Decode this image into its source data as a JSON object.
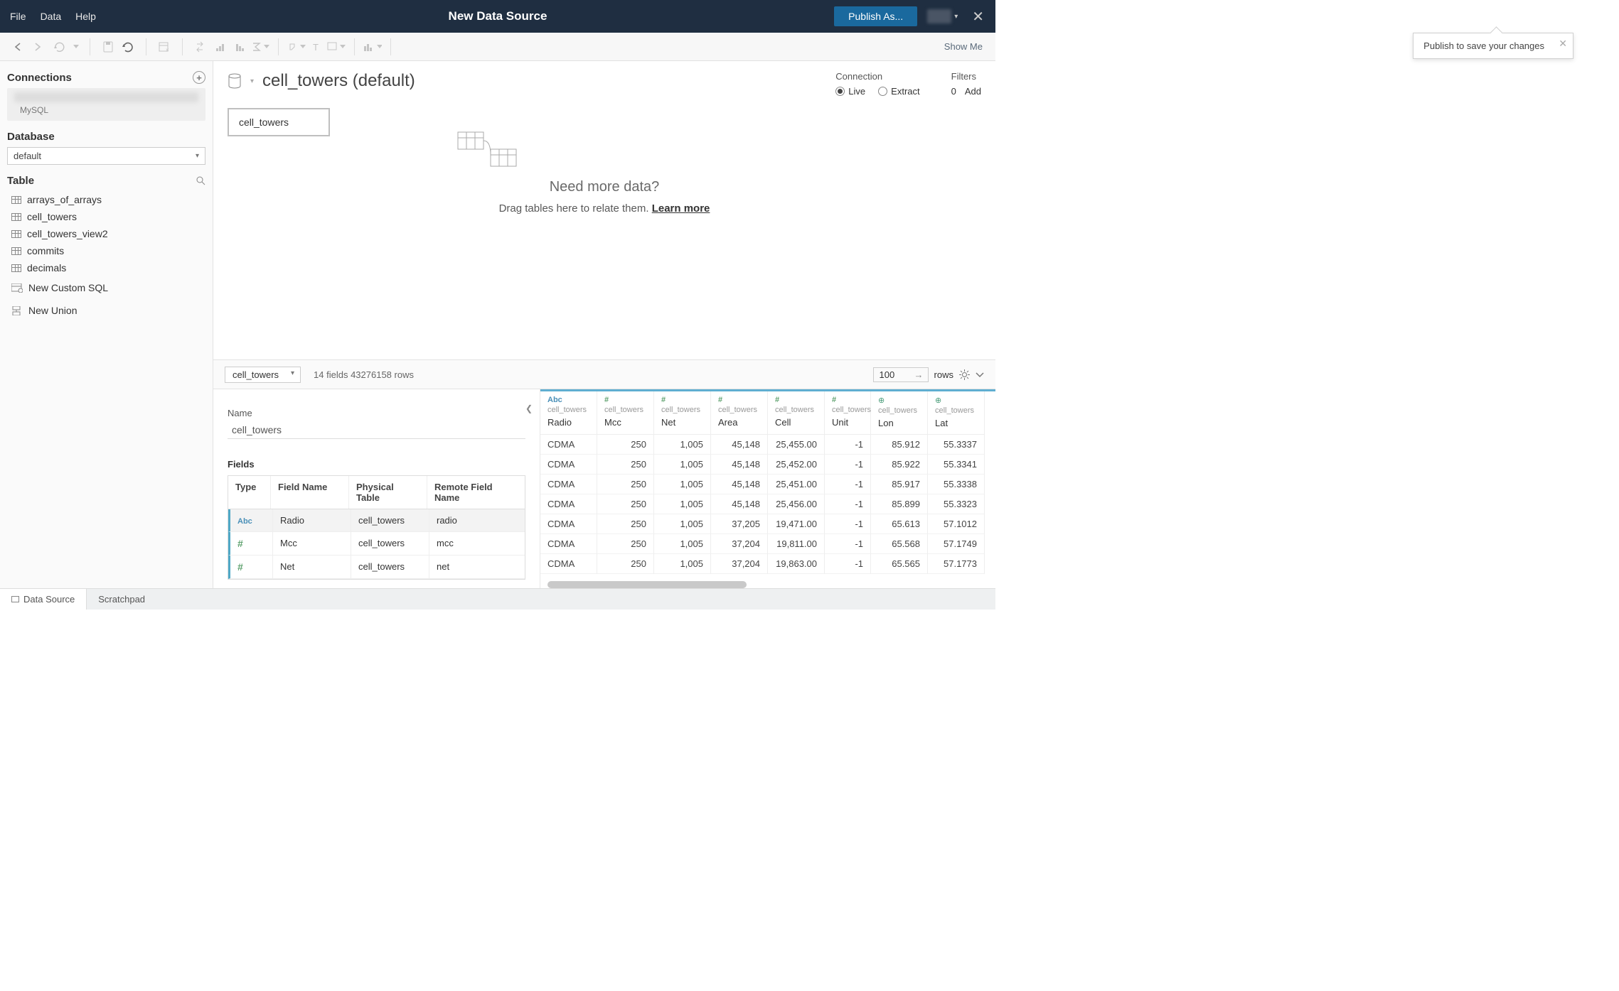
{
  "menubar": {
    "file": "File",
    "data": "Data",
    "help": "Help"
  },
  "titlebar": {
    "title": "New Data Source",
    "publish": "Publish As..."
  },
  "tooltip": {
    "text": "Publish to save your changes"
  },
  "showme": "Show Me",
  "sidebar": {
    "connections_label": "Connections",
    "connection_type": "MySQL",
    "database_label": "Database",
    "database_value": "default",
    "table_label": "Table",
    "tables": [
      "arrays_of_arrays",
      "cell_towers",
      "cell_towers_view2",
      "commits",
      "decimals"
    ],
    "custom_sql": "New Custom SQL",
    "new_union": "New Union"
  },
  "canvas": {
    "datasource_name": "cell_towers (default)",
    "chip": "cell_towers",
    "connection_label": "Connection",
    "live": "Live",
    "extract": "Extract",
    "filters_label": "Filters",
    "filters_count": "0",
    "filters_add": "Add",
    "need_more": "Need more data?",
    "drag_here": "Drag tables here to relate them. ",
    "learn_more": "Learn more"
  },
  "lower": {
    "table_select": "cell_towers",
    "fields_info": "14 fields 43276158 rows",
    "rows_value": "100",
    "rows_label": "rows",
    "name_label": "Name",
    "name_value": "cell_towers",
    "fields_label": "Fields",
    "ft_headers": {
      "type": "Type",
      "field": "Field Name",
      "physical": "Physical Table",
      "remote": "Remote Field Name"
    },
    "ft_rows": [
      {
        "type": "Abc",
        "field": "Radio",
        "physical": "cell_towers",
        "remote": "radio"
      },
      {
        "type": "#",
        "field": "Mcc",
        "physical": "cell_towers",
        "remote": "mcc"
      },
      {
        "type": "#",
        "field": "Net",
        "physical": "cell_towers",
        "remote": "net"
      }
    ]
  },
  "grid": {
    "source": "cell_towers",
    "columns": [
      {
        "name": "Radio",
        "type": "Abc"
      },
      {
        "name": "Mcc",
        "type": "#"
      },
      {
        "name": "Net",
        "type": "#"
      },
      {
        "name": "Area",
        "type": "#"
      },
      {
        "name": "Cell",
        "type": "#"
      },
      {
        "name": "Unit",
        "type": "#"
      },
      {
        "name": "Lon",
        "type": "geo"
      },
      {
        "name": "Lat",
        "type": "geo"
      }
    ],
    "rows": [
      [
        "CDMA",
        "250",
        "1,005",
        "45,148",
        "25,455.00",
        "-1",
        "85.912",
        "55.3337"
      ],
      [
        "CDMA",
        "250",
        "1,005",
        "45,148",
        "25,452.00",
        "-1",
        "85.922",
        "55.3341"
      ],
      [
        "CDMA",
        "250",
        "1,005",
        "45,148",
        "25,451.00",
        "-1",
        "85.917",
        "55.3338"
      ],
      [
        "CDMA",
        "250",
        "1,005",
        "45,148",
        "25,456.00",
        "-1",
        "85.899",
        "55.3323"
      ],
      [
        "CDMA",
        "250",
        "1,005",
        "37,205",
        "19,471.00",
        "-1",
        "65.613",
        "57.1012"
      ],
      [
        "CDMA",
        "250",
        "1,005",
        "37,204",
        "19,811.00",
        "-1",
        "65.568",
        "57.1749"
      ],
      [
        "CDMA",
        "250",
        "1,005",
        "37,204",
        "19,863.00",
        "-1",
        "65.565",
        "57.1773"
      ]
    ]
  },
  "tabs": {
    "datasource": "Data Source",
    "scratchpad": "Scratchpad"
  }
}
